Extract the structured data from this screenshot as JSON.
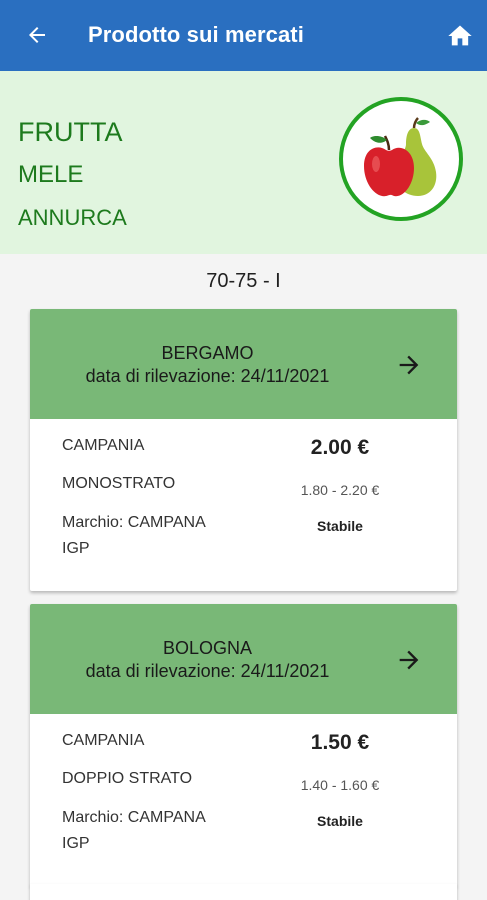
{
  "appbar": {
    "title": "Prodotto sui mercati",
    "back_icon": "arrow-left-icon",
    "home_icon": "home-icon",
    "color": "#2a6fc0"
  },
  "product": {
    "category": "FRUTTA",
    "type": "MELE",
    "variety": "ANNURCA",
    "image_icon": "apple-pear-icon"
  },
  "caliber": "70-75 - I",
  "markets": [
    {
      "city": "BERGAMO",
      "date_label": "data di rilevazione: 24/11/2021",
      "origin": "CAMPANIA",
      "packaging": "MONOSTRATO",
      "brand_line1": "Marchio: CAMPANA",
      "brand_line2": "IGP",
      "price": "2.00 €",
      "range": "1.80 - 2.20 €",
      "trend": "Stabile"
    },
    {
      "city": "BOLOGNA",
      "date_label": "data di rilevazione: 24/11/2021",
      "origin": "CAMPANIA",
      "packaging": "DOPPIO STRATO",
      "brand_line1": "Marchio: CAMPANA",
      "brand_line2": "IGP",
      "price": "1.50 €",
      "range": "1.40 - 1.60 €",
      "trend": "Stabile"
    }
  ],
  "colors": {
    "header_green": "#79b877",
    "hero_bg": "#e1f5df",
    "hero_text": "#1d7a1d"
  }
}
